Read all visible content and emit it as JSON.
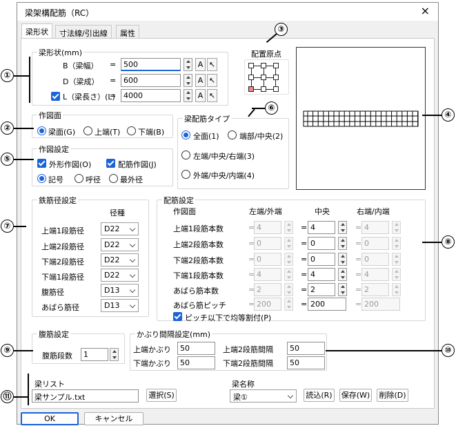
{
  "title": "梁架構配筋（RC）",
  "close_icon": "×",
  "tabs": [
    "梁形状",
    "寸法線/引出線",
    "属性"
  ],
  "shape_group": {
    "label": "梁形状(mm)",
    "rows": [
      {
        "label": "B（梁幅）",
        "eq": "=",
        "value": "500",
        "a": "A"
      },
      {
        "label": "D（梁成）",
        "eq": "=",
        "value": "600",
        "a": "A"
      },
      {
        "label": "L（梁長さ）(L)",
        "eq": "=",
        "value": "4000",
        "a": "A"
      }
    ]
  },
  "origin_label": "配置原点",
  "draw_face": {
    "label": "作図面",
    "options": [
      "梁面(G)",
      "上端(T)",
      "下端(B)"
    ]
  },
  "draw_setting": {
    "label": "作図設定",
    "outline": "外形作図(O)",
    "rebar": "配筋作図(J)",
    "options": [
      "記号",
      "呼径",
      "最外径"
    ]
  },
  "rebar_type": {
    "label": "梁配筋タイプ",
    "options": [
      "全面(1)",
      "端部/中央(2)",
      "左端/中央/右端(3)",
      "外端/中央/内端(4)"
    ]
  },
  "diameter": {
    "label": "鉄筋径設定",
    "header": "径種",
    "rows": [
      {
        "label": "上端1段筋径",
        "value": "D22"
      },
      {
        "label": "上端2段筋径",
        "value": "D22"
      },
      {
        "label": "下端2段筋径",
        "value": "D22"
      },
      {
        "label": "下端1段筋径",
        "value": "D22"
      },
      {
        "label": "腹筋径",
        "value": "D13"
      },
      {
        "label": "あばら筋径",
        "value": "D13"
      }
    ]
  },
  "arrangement": {
    "label": "配筋設定",
    "headers": [
      "作図面",
      "左端/外端",
      "中央",
      "右端/内端"
    ],
    "rows": [
      {
        "label": "上端1段筋本数",
        "left": "4",
        "mid": "4",
        "right": "4"
      },
      {
        "label": "上端2段筋本数",
        "left": "0",
        "mid": "0",
        "right": "0"
      },
      {
        "label": "下端2段筋本数",
        "left": "0",
        "mid": "0",
        "right": "0"
      },
      {
        "label": "下端1段筋本数",
        "left": "4",
        "mid": "4",
        "right": "4"
      },
      {
        "label": "あばら筋本数",
        "left": "2",
        "mid": "2",
        "right": "2"
      },
      {
        "label": "あばら筋ピッチ",
        "left": "200",
        "mid": "200",
        "right": "200"
      }
    ],
    "pitch_check": "ピッチ以下で均等割付(P)"
  },
  "web": {
    "label": "腹筋設定",
    "count_label": "腹筋段数",
    "count": "1"
  },
  "cover": {
    "label": "かぶり間隔設定(mm)",
    "top_label": "上端かぶり",
    "top": "50",
    "bottom_label": "下端かぶり",
    "bottom": "50",
    "top2_label": "上端2段筋間隔",
    "top2": "50",
    "bottom2_label": "下端2段筋間隔",
    "bottom2": "50"
  },
  "list": {
    "label": "梁リスト",
    "file": "梁サンプル.txt",
    "select": "選択(S)"
  },
  "name": {
    "label": "梁名称",
    "value": "梁①",
    "read": "読込(R)",
    "save": "保存(W)",
    "delete": "削除(D)"
  },
  "ok": "OK",
  "cancel": "キャンセル",
  "eq": "=",
  "callouts": [
    "①",
    "②",
    "③",
    "④",
    "⑤",
    "⑥",
    "⑦",
    "⑧",
    "⑨",
    "⑩",
    "⑪"
  ]
}
